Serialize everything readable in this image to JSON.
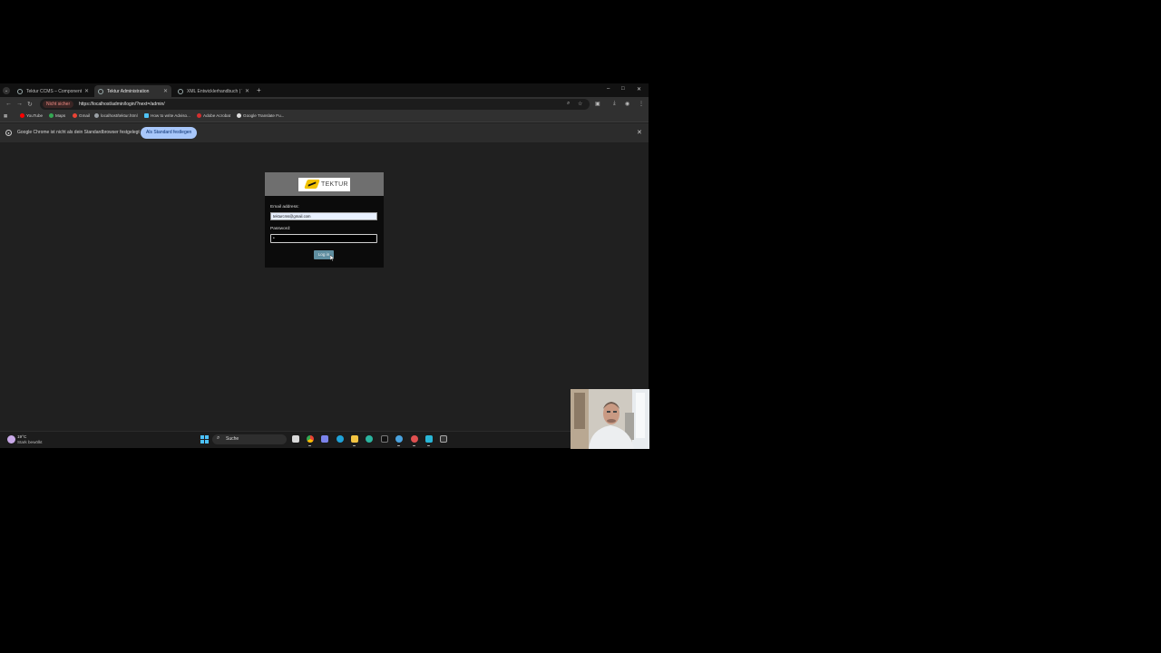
{
  "browser": {
    "tabs": [
      {
        "title": "Tektur CCMS – Component Co",
        "active": false
      },
      {
        "title": "Tektur Administration",
        "active": true
      },
      {
        "title": "XML Entwicklerhandbuch | Tekt",
        "active": false
      }
    ],
    "new_tab_symbol": "+",
    "window_controls": {
      "minimize": "–",
      "maximize": "□",
      "close": "✕"
    }
  },
  "toolbar": {
    "security_label": "Nicht sicher",
    "url": "https://localhost/admin/login/?next=/admin/",
    "icons": [
      "back-arrow-icon",
      "forward-arrow-icon",
      "reload-icon",
      "zoom-icon",
      "star-icon",
      "extensions-icon",
      "download-icon",
      "profile-icon",
      "menu-icon"
    ]
  },
  "bookmarks": [
    {
      "label": "YouTube",
      "icon": "youtube-icon",
      "color": "#ff0000"
    },
    {
      "label": "Maps",
      "icon": "maps-icon",
      "color": "#34a853"
    },
    {
      "label": "Gmail",
      "icon": "gmail-icon",
      "color": "#ea4335"
    },
    {
      "label": "localhost/tektur.html",
      "icon": "globe-icon",
      "color": "#9aa0a6"
    },
    {
      "label": "How to write Adviso...",
      "icon": "page-icon",
      "color": "#4fc3f7"
    },
    {
      "label": "Adobe Acrobat",
      "icon": "acrobat-icon",
      "color": "#d32f2f"
    },
    {
      "label": "Google Translate Fu...",
      "icon": "github-icon",
      "color": "#e0e0e0"
    }
  ],
  "infobar": {
    "message": "Google Chrome ist nicht als dein Standardbrowser festgelegt",
    "button_label": "Als Standard festlegen",
    "close_symbol": "✕"
  },
  "login": {
    "logo_text": "TEKTUR",
    "email_label": "Email address:",
    "email_value": "tekturcms@gmail.com",
    "password_label": "Password:",
    "password_value": "•",
    "submit_label": "Log in",
    "accent_color": "#5f8ea0"
  },
  "taskbar": {
    "weather_temp": "19°C",
    "weather_desc": "Stark bewölkt",
    "search_placeholder": "Suche",
    "apps": [
      "file-explorer-icon",
      "chrome-icon",
      "teams-icon",
      "edge-icon",
      "folder-icon",
      "copilot-icon",
      "terminal-icon",
      "browser-icon",
      "app-icon",
      "notepad-icon",
      "console-icon"
    ]
  }
}
